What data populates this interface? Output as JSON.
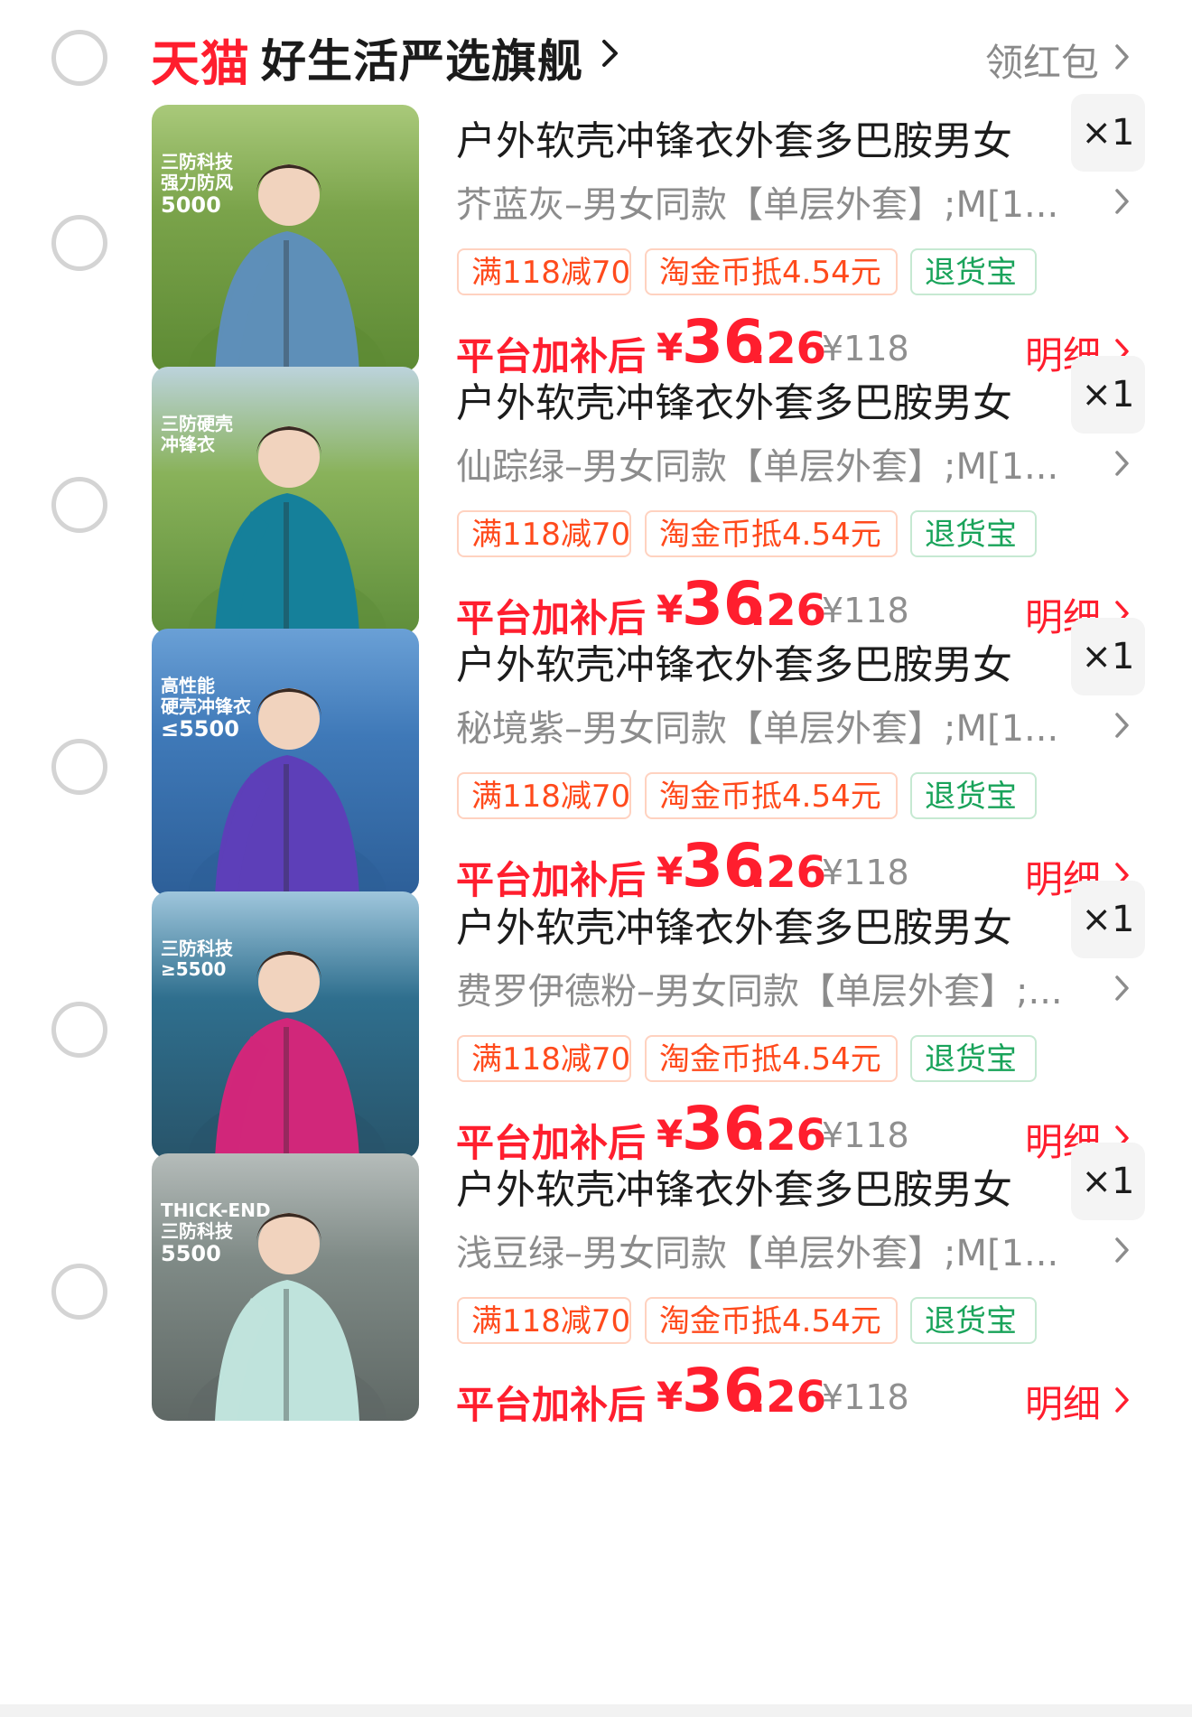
{
  "store": {
    "brand": "天猫",
    "name": "好生活严选旗舰",
    "coupon_label": "领红包"
  },
  "common": {
    "tag_discount": "满118减70",
    "tag_coins": "淘金币抵4.54元",
    "tag_return": "退货宝",
    "price_label": "平台加补后",
    "currency": "¥",
    "price_int": "36",
    "price_dec": ".26",
    "original_price": "¥118",
    "detail_label": "明细",
    "qty": "×1"
  },
  "items": [
    {
      "title": "户外软壳冲锋衣外套多巴胺男女",
      "sku": "芥蓝灰–男女同款【单层外套】;M[1...",
      "image_text": [
        "三防科技",
        "强力防风",
        "5000"
      ],
      "colors": {
        "bg": "#7aa34a",
        "bg2": "#5d8a34",
        "jacket": "#5e8fb8",
        "sky": "#a9c97a"
      }
    },
    {
      "title": "户外软壳冲锋衣外套多巴胺男女",
      "sku": "仙踪绿–男女同款【单层外套】;M[1...",
      "image_text": [
        "三防硬壳",
        "冲锋衣",
        ""
      ],
      "colors": {
        "bg": "#89b25a",
        "bg2": "#5f8e3b",
        "jacket": "#15809a",
        "sky": "#bcd3dc"
      }
    },
    {
      "title": "户外软壳冲锋衣外套多巴胺男女",
      "sku": "秘境紫–男女同款【单层外套】;M[1...",
      "image_text": [
        "高性能",
        "硬壳冲锋衣",
        "≤5500"
      ],
      "colors": {
        "bg": "#3f79b8",
        "bg2": "#2d5f98",
        "jacket": "#5d3fb8",
        "sky": "#6aa0d6"
      }
    },
    {
      "title": "户外软壳冲锋衣外套多巴胺男女",
      "sku": "费罗伊德粉–男女同款【单层外套】;...",
      "image_text": [
        "三防科技",
        "≥5500",
        ""
      ],
      "colors": {
        "bg": "#2f6f8e",
        "bg2": "#28546a",
        "jacket": "#d1277a",
        "sky": "#9fc6dc"
      }
    },
    {
      "title": "户外软壳冲锋衣外套多巴胺男女",
      "sku": "浅豆绿–男女同款【单层外套】;M[1...",
      "image_text": [
        "THICK-END",
        "三防科技",
        "5500"
      ],
      "colors": {
        "bg": "#7f8a86",
        "bg2": "#5f6865",
        "jacket": "#bfe3dc",
        "sky": "#b5bcba"
      }
    }
  ]
}
